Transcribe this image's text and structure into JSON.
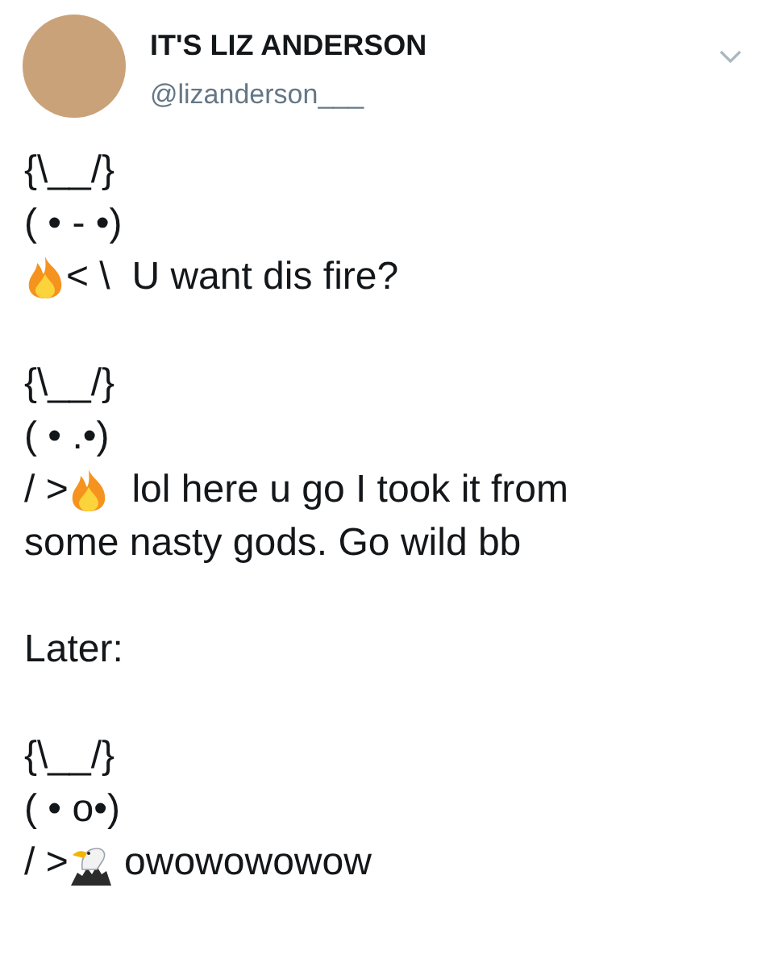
{
  "tweet": {
    "author": {
      "name": "IT'S LIZ ANDERSON",
      "handle": "@lizanderson___"
    },
    "paragraphs": [
      {
        "lines": [
          {
            "parts": [
              {
                "kind": "text",
                "text": "{\\__/}"
              }
            ]
          },
          {
            "parts": [
              {
                "kind": "text",
                "text": "( • - •)"
              }
            ]
          },
          {
            "parts": [
              {
                "kind": "fire"
              },
              {
                "kind": "text",
                "text": "< \\  U want dis fire?"
              }
            ]
          }
        ]
      },
      {
        "lines": [
          {
            "parts": [
              {
                "kind": "text",
                "text": "{\\__/}"
              }
            ]
          },
          {
            "parts": [
              {
                "kind": "text",
                "text": "( • .•)"
              }
            ]
          },
          {
            "parts": [
              {
                "kind": "text",
                "text": "/ >"
              },
              {
                "kind": "fire"
              },
              {
                "kind": "text",
                "text": "  lol here u go I took it from"
              }
            ]
          },
          {
            "parts": [
              {
                "kind": "text",
                "text": "some nasty gods. Go wild bb"
              }
            ]
          }
        ]
      },
      {
        "lines": [
          {
            "parts": [
              {
                "kind": "text",
                "text": "Later:"
              }
            ]
          }
        ]
      },
      {
        "lines": [
          {
            "parts": [
              {
                "kind": "text",
                "text": "{\\__/}"
              }
            ]
          },
          {
            "parts": [
              {
                "kind": "text",
                "text": "( • o•)"
              }
            ]
          },
          {
            "parts": [
              {
                "kind": "text",
                "text": "/ >"
              },
              {
                "kind": "eagle"
              },
              {
                "kind": "text",
                "text": " owowowowow"
              }
            ]
          }
        ]
      }
    ]
  }
}
